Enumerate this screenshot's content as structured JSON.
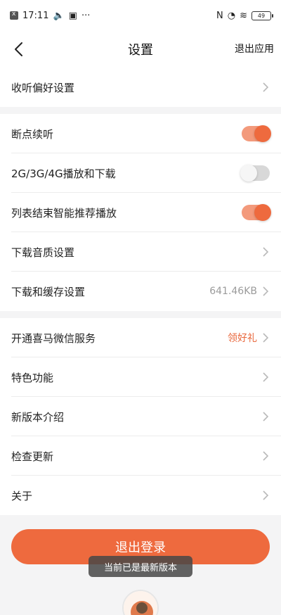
{
  "status_bar": {
    "time": "17:11",
    "battery": "49"
  },
  "header": {
    "title": "设置",
    "right_action": "退出应用"
  },
  "sections": {
    "s1": [
      {
        "label": "收听偏好设置"
      }
    ],
    "s2": [
      {
        "label": "断点续听",
        "toggle": "on"
      },
      {
        "label": "2G/3G/4G播放和下载",
        "toggle": "off"
      },
      {
        "label": "列表结束智能推荐播放",
        "toggle": "on"
      },
      {
        "label": "下载音质设置"
      },
      {
        "label": "下载和缓存设置",
        "value": "641.46KB"
      }
    ],
    "s3": [
      {
        "label": "开通喜马微信服务",
        "value": "领好礼"
      },
      {
        "label": "特色功能"
      },
      {
        "label": "新版本介绍"
      },
      {
        "label": "检查更新"
      },
      {
        "label": "关于"
      }
    ]
  },
  "logout_button": "退出登录",
  "toast": "当前已是最新版本",
  "colors": {
    "accent": "#ee6a3e",
    "toggle_on_track": "#f39a7c",
    "background": "#f4f4f5"
  }
}
